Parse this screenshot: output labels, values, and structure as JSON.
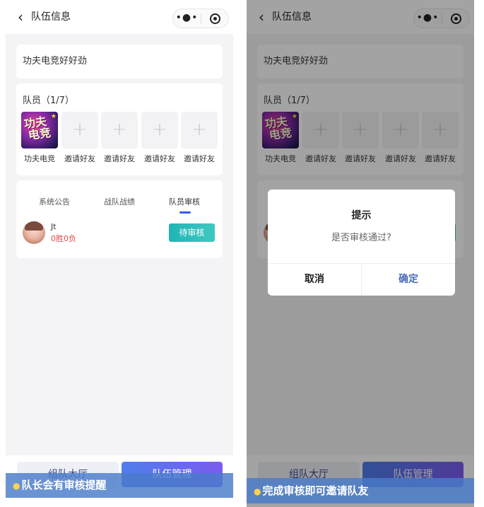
{
  "screens": [
    {
      "nav": {
        "back_icon": "chevron-left-icon",
        "title": "队伍信息",
        "more_label": "•●•"
      },
      "team_name": "功夫电竞好好劲",
      "members_title": "队员（1/7）",
      "members": [
        {
          "label": "功夫电竞",
          "type": "game-logo"
        },
        {
          "label": "邀请好友",
          "type": "invite"
        },
        {
          "label": "邀请好友",
          "type": "invite"
        },
        {
          "label": "邀请好友",
          "type": "invite"
        },
        {
          "label": "邀请好友",
          "type": "invite"
        }
      ],
      "logo_text_1": "功夫",
      "logo_text_2": "电竞",
      "tabs": [
        "系统公告",
        "战队战绩",
        "队员审核"
      ],
      "active_tab": "队员审核",
      "applicant": {
        "name": "Jt",
        "record": "0胜0负",
        "action": "待审核"
      },
      "bottom": {
        "hall": "组队大厅",
        "manage": "队伍管理"
      },
      "caption": "队长会有审核提醒"
    },
    {
      "nav": {
        "back_icon": "chevron-left-icon",
        "title": "队伍信息",
        "more_label": "•●•"
      },
      "team_name": "功夫电竞好好劲",
      "members_title": "队员（1/7）",
      "members": [
        {
          "label": "功夫电竞",
          "type": "game-logo"
        },
        {
          "label": "邀请好友",
          "type": "invite"
        },
        {
          "label": "邀请好友",
          "type": "invite"
        },
        {
          "label": "邀请好友",
          "type": "invite"
        },
        {
          "label": "邀请好友",
          "type": "invite"
        }
      ],
      "logo_text_1": "功夫",
      "logo_text_2": "电竞",
      "applicant": {
        "name": "",
        "record": "",
        "action": ""
      },
      "bottom": {
        "hall": "组队大厅",
        "manage": "队伍管理"
      },
      "dialog": {
        "title": "提示",
        "message": "是否审核通过?",
        "cancel": "取消",
        "confirm": "确定"
      },
      "caption": "完成审核即可邀请队友"
    }
  ],
  "colors": {
    "accent_blue": "#3b58e6",
    "pending_teal": "#1fb5b5",
    "record_red": "#e24d4d",
    "caption_bg": "#497bc9",
    "caption_dot": "#ffd24a"
  }
}
